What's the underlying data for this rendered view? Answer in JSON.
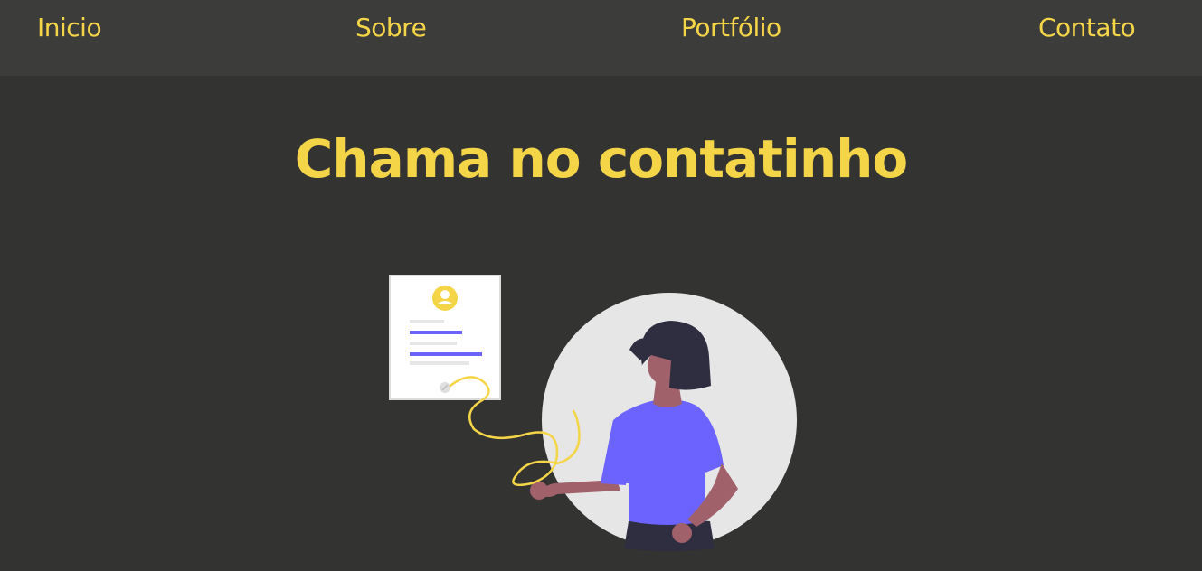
{
  "nav": {
    "items": [
      {
        "label": "Inicio"
      },
      {
        "label": "Sobre"
      },
      {
        "label": "Portfólio"
      },
      {
        "label": "Contato"
      }
    ]
  },
  "main": {
    "title": "Chama no contatinho"
  },
  "colors": {
    "accent": "#f5d548",
    "background": "#333332",
    "navbar": "#3c3c3b",
    "purple": "#6c63ff"
  },
  "illustration": {
    "icon": "woman-with-profile-card-illustration"
  }
}
